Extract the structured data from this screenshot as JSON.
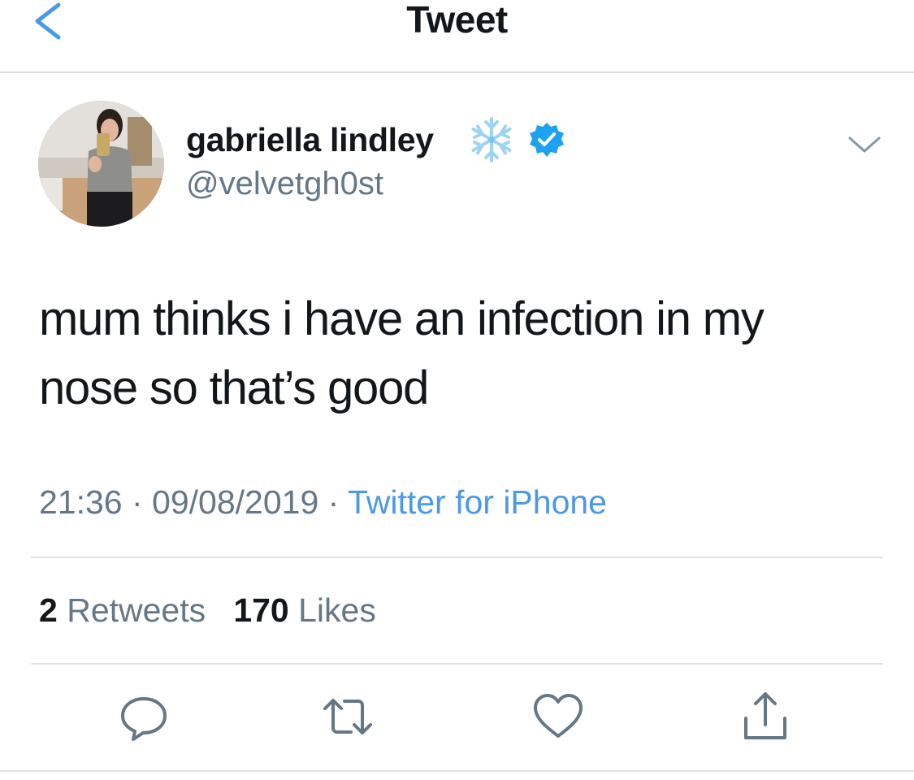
{
  "nav": {
    "title": "Tweet",
    "back_icon": "chevron-left-icon"
  },
  "tweet": {
    "display_name": "gabriella lindley",
    "name_emoji": "❄️",
    "verified": true,
    "handle": "@velvetgh0st",
    "text": "mum thinks i have an infection in my nose so that’s good",
    "time": "21:36",
    "date": "09/08/2019",
    "separator": " · ",
    "source": "Twitter for iPhone",
    "retweets_count": "2",
    "retweets_label": " Retweets",
    "likes_count": "170",
    "likes_label": " Likes"
  },
  "actions": [
    {
      "name": "reply",
      "icon": "reply-icon"
    },
    {
      "name": "retweet",
      "icon": "retweet-icon"
    },
    {
      "name": "like",
      "icon": "heart-icon"
    },
    {
      "name": "share",
      "icon": "share-icon"
    }
  ],
  "colors": {
    "accent": "#4a99e9",
    "verified": "#1da1f2",
    "text_primary": "#14171a",
    "text_secondary": "#657786",
    "divider": "#dfe3e6"
  }
}
